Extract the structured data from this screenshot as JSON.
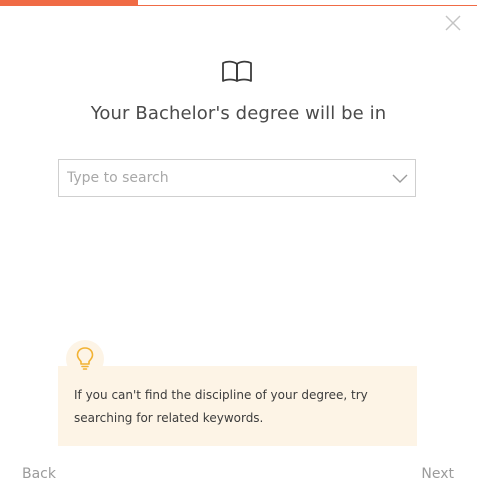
{
  "progress": {
    "fraction": 0.29,
    "color": "#f06b45"
  },
  "header": {
    "close_icon": "close-icon",
    "book_icon": "book-icon"
  },
  "main": {
    "title": "Your Bachelor's degree will be in",
    "search": {
      "placeholder": "Type to search",
      "value": ""
    }
  },
  "tip": {
    "icon": "lightbulb-icon",
    "text": "If you can't find the discipline of your degree, try searching for related keywords.",
    "background": "#fdf4e6"
  },
  "footer": {
    "back_label": "Back",
    "next_label": "Next"
  }
}
